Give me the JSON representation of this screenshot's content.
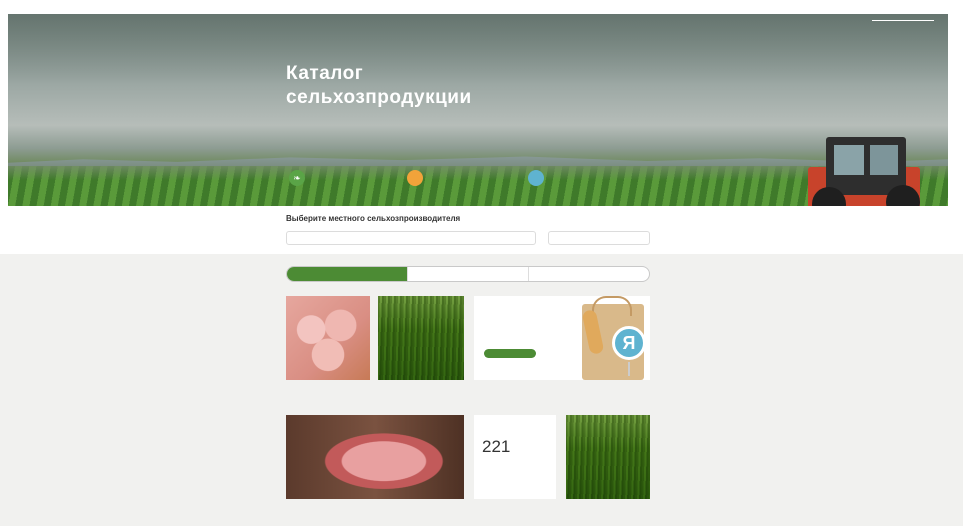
{
  "header": {
    "title_line1": "Каталог",
    "title_line2": "сельхозпродукции",
    "top_link_1": "",
    "top_link_2": ""
  },
  "features": [
    {
      "icon": "leaf-icon",
      "label_1": "",
      "label_2": ""
    },
    {
      "icon": "coin-icon",
      "label_1": "",
      "label_2": ""
    },
    {
      "icon": "globe-icon",
      "label_1": "",
      "label_2": ""
    }
  ],
  "search": {
    "title": "Выберите местного сельхозпроизводителя",
    "query_placeholder": "",
    "region_placeholder": ""
  },
  "tabs": [
    {
      "label": "",
      "active": true
    },
    {
      "label": "",
      "active": false
    },
    {
      "label": "",
      "active": false
    }
  ],
  "products": [
    {
      "title": "",
      "desc": ""
    },
    {
      "title": "",
      "desc": ""
    },
    {
      "title": "",
      "desc": ""
    },
    {
      "title": "",
      "desc": ""
    }
  ],
  "promo": {
    "text": "",
    "button": "",
    "logo_letter": "Я"
  },
  "stat": {
    "number": "221",
    "text": ""
  },
  "colors": {
    "accent_green": "#4c8b34",
    "orange": "#f2a33a",
    "blue": "#5fb3d0",
    "page_grey": "#f1f1ef"
  }
}
